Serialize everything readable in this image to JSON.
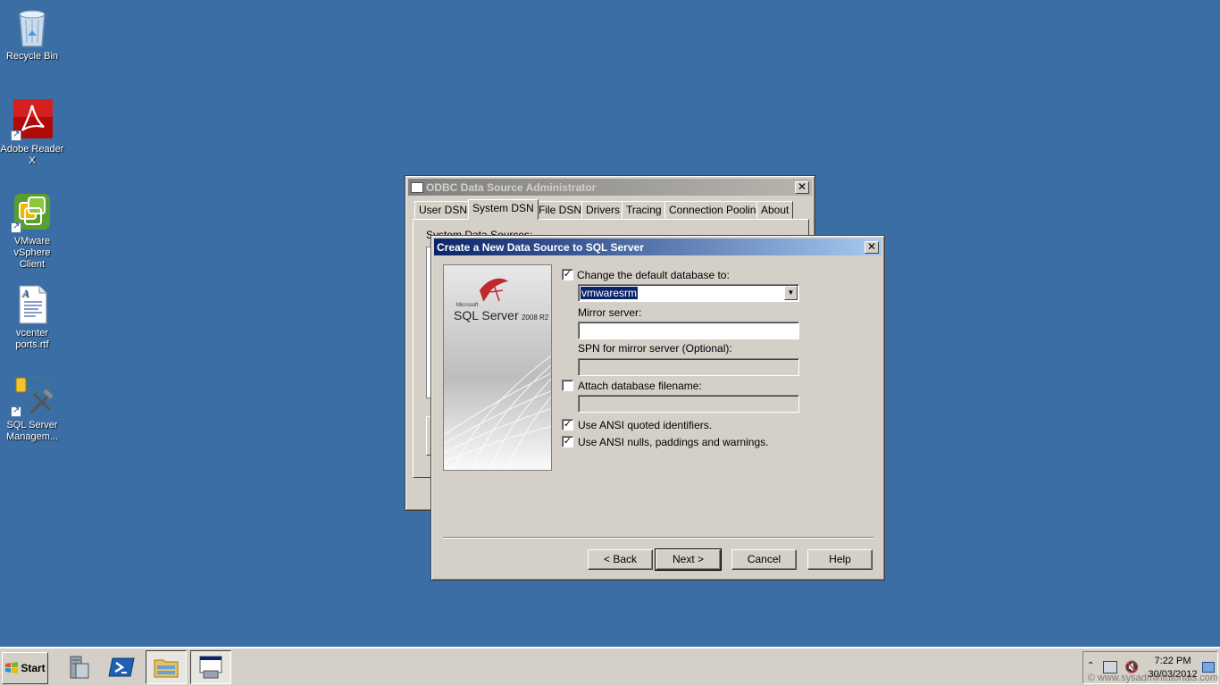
{
  "desktop": {
    "icons": [
      {
        "label": "Recycle Bin",
        "icon": "recycle-bin-icon"
      },
      {
        "label": "Adobe Reader X",
        "icon": "adobe-reader-icon"
      },
      {
        "label": "VMware vSphere Client",
        "icon": "vsphere-icon"
      },
      {
        "label": "vcenter ports.rtf",
        "icon": "rtf-document-icon"
      },
      {
        "label": "SQL Server Managem...",
        "icon": "sql-server-management-icon"
      }
    ]
  },
  "odbc": {
    "title": "ODBC Data Source Administrator",
    "tabs": [
      "User DSN",
      "System DSN",
      "File DSN",
      "Drivers",
      "Tracing",
      "Connection Pooling",
      "About"
    ],
    "selected_tab": "System DSN",
    "partial_label": "System Data Sources:"
  },
  "dialog": {
    "title": "Create a New Data Source to SQL Server",
    "logo": {
      "small": "Microsoft",
      "product": "SQL Server",
      "version": "2008 R2"
    },
    "change_db": {
      "label": "Change the default database to:",
      "checked": true,
      "value": "vmwaresrm"
    },
    "mirror": {
      "label": "Mirror server:",
      "value": ""
    },
    "spn": {
      "label": "SPN for mirror server (Optional):",
      "value": ""
    },
    "attach": {
      "label": "Attach database filename:",
      "checked": false,
      "value": ""
    },
    "ansi_quoted": {
      "label": "Use ANSI quoted identifiers.",
      "checked": true
    },
    "ansi_nulls": {
      "label": "Use ANSI nulls, paddings and warnings.",
      "checked": true
    },
    "buttons": {
      "back": "< Back",
      "next": "Next >",
      "cancel": "Cancel",
      "help": "Help"
    }
  },
  "taskbar": {
    "start": "Start",
    "clock_time": "7:22 PM",
    "clock_date": "30/03/2012",
    "watermark": "© www.sysadmintutorials.com"
  },
  "colors": {
    "desktop": "#3a6ea5",
    "active_title": "#0a246a",
    "inactive_title": "#808080",
    "window_face": "#d4d0c8"
  }
}
